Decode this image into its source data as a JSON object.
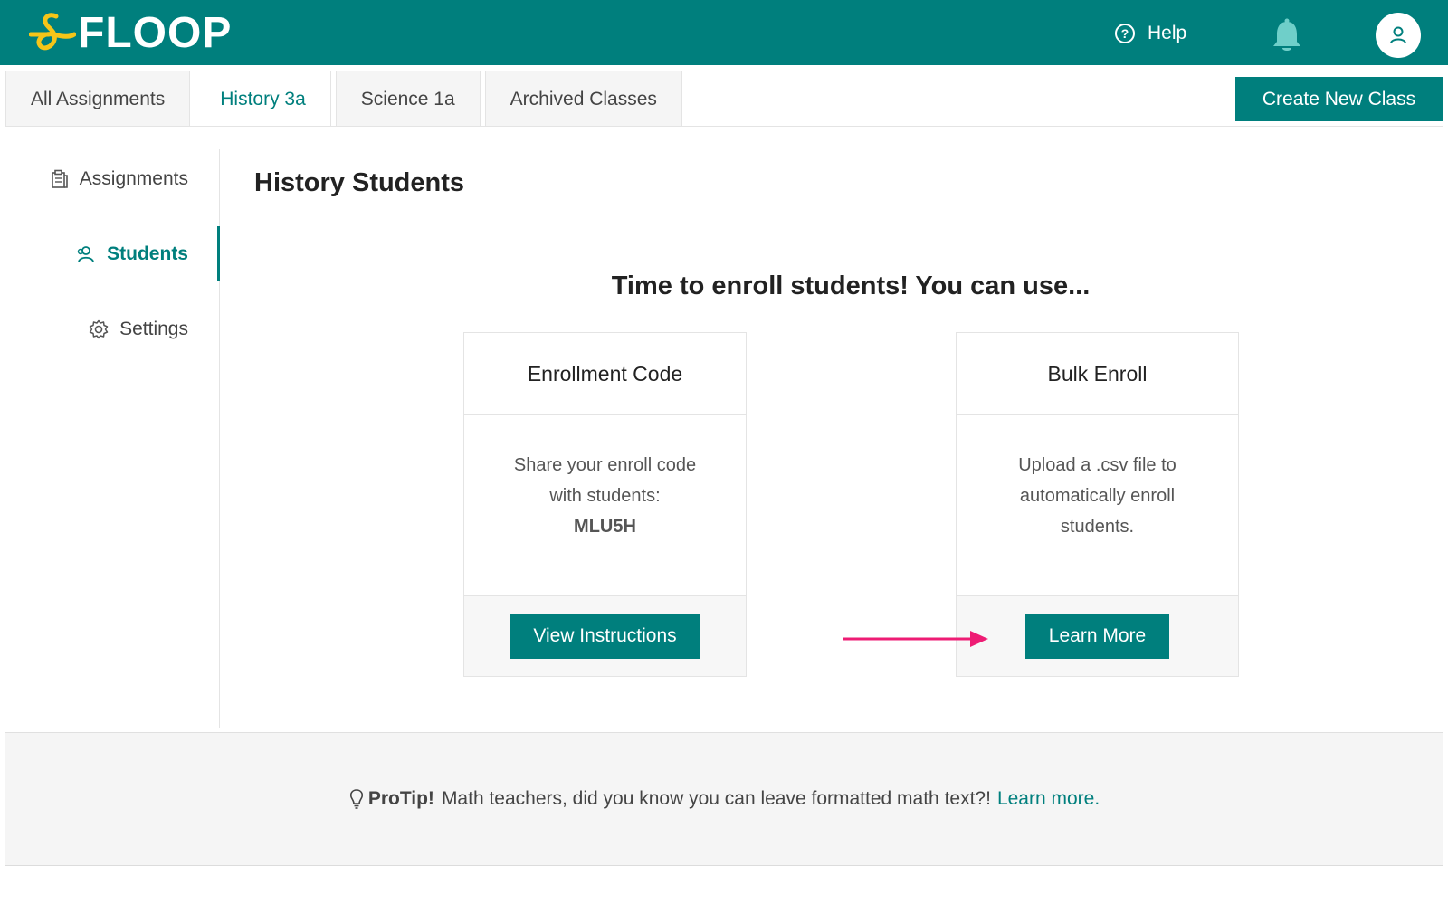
{
  "header": {
    "logo_text": "FLOOP",
    "help_label": "Help",
    "icons": {
      "help": "help-circle-icon",
      "bell": "bell-icon",
      "avatar": "user-icon"
    }
  },
  "tabs": [
    {
      "label": "All Assignments",
      "active": false
    },
    {
      "label": "History 3a",
      "active": true
    },
    {
      "label": "Science 1a",
      "active": false
    },
    {
      "label": "Archived Classes",
      "active": false
    }
  ],
  "create_class_label": "Create New Class",
  "sidebar": {
    "items": [
      {
        "label": "Assignments",
        "icon": "clipboard-icon",
        "active": false
      },
      {
        "label": "Students",
        "icon": "users-icon",
        "active": true
      },
      {
        "label": "Settings",
        "icon": "gear-icon",
        "active": false
      }
    ]
  },
  "main": {
    "title": "History Students",
    "heading": "Time to enroll students! You can use...",
    "cards": [
      {
        "title": "Enrollment Code",
        "line1": "Share your enroll code",
        "line2": "with students:",
        "code": "MLU5H",
        "button": "View Instructions"
      },
      {
        "title": "Bulk Enroll",
        "line1": "Upload a .csv file to",
        "line2": "automatically enroll",
        "line3": "students.",
        "button": "Learn More"
      }
    ]
  },
  "protip": {
    "label": "ProTip!",
    "text": "Math teachers, did you know you can leave formatted math text?!",
    "link": "Learn more."
  },
  "colors": {
    "brand": "#007f7d",
    "logo_accent": "#f5c518",
    "arrow": "#ee1c74"
  }
}
